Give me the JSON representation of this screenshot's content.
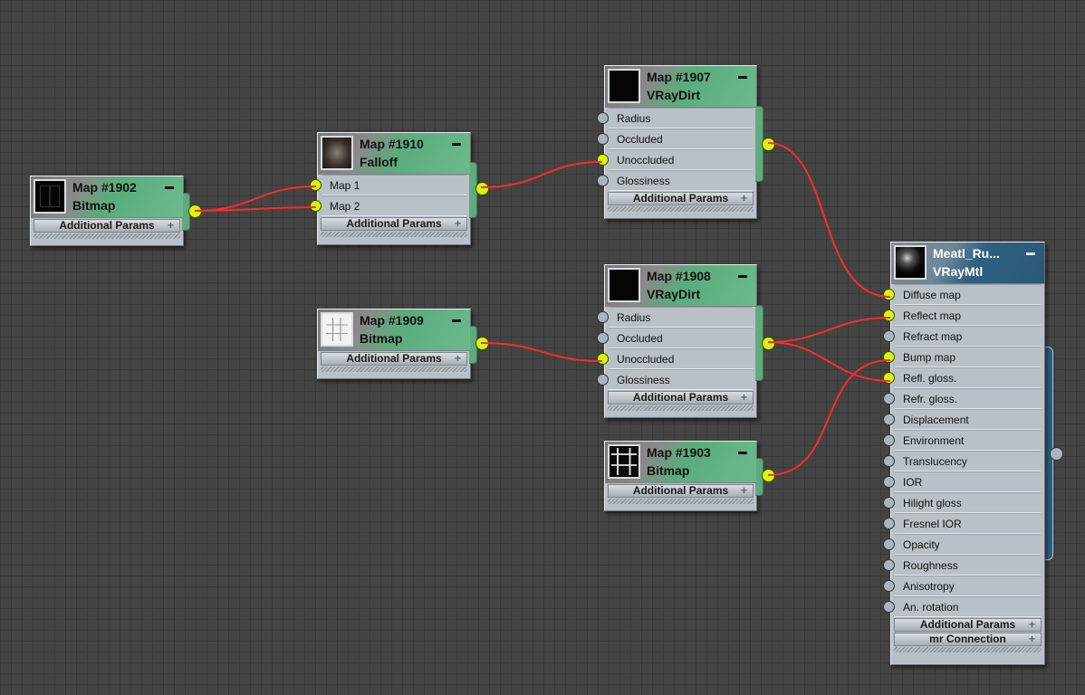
{
  "nodes": {
    "n1902": {
      "map": "Map #1902",
      "type": "Bitmap",
      "sub": [
        "Additional Params"
      ]
    },
    "n1910": {
      "map": "Map #1910",
      "type": "Falloff",
      "slots": [
        "Map 1",
        "Map 2"
      ],
      "sub": [
        "Additional Params"
      ]
    },
    "n1907": {
      "map": "Map #1907",
      "type": "VRayDirt",
      "slots": [
        "Radius",
        "Occluded",
        "Unoccluded",
        "Glossiness"
      ],
      "sub": [
        "Additional Params"
      ]
    },
    "n1909": {
      "map": "Map #1909",
      "type": "Bitmap",
      "sub": [
        "Additional Params"
      ]
    },
    "n1908": {
      "map": "Map #1908",
      "type": "VRayDirt",
      "slots": [
        "Radius",
        "Occluded",
        "Unoccluded",
        "Glossiness"
      ],
      "sub": [
        "Additional Params"
      ]
    },
    "n1903": {
      "map": "Map #1903",
      "type": "Bitmap",
      "sub": [
        "Additional Params"
      ]
    },
    "mtl": {
      "map": "Meatl_Ru...",
      "type": "VRayMtl",
      "slots": [
        "Diffuse map",
        "Reflect map",
        "Refract map",
        "Bump map",
        "Refl. gloss.",
        "Refr. gloss.",
        "Displacement",
        "Environment",
        "Translucency",
        "IOR",
        "Hilight gloss",
        "Fresnel IOR",
        "Opacity",
        "Roughness",
        "Anisotropy",
        "An. rotation"
      ],
      "sub": [
        "Additional Params",
        "mr Connection"
      ]
    }
  },
  "plus_glyph": "+",
  "colors": {
    "canvas": "#444444",
    "node_header_green": "#5aac7c",
    "node_header_blue": "#2c5878",
    "node_body": "#b9c0c6",
    "wire": "#ff2a2a",
    "port_connected": "#d7f50e",
    "port_empty": "#aab4bf"
  }
}
